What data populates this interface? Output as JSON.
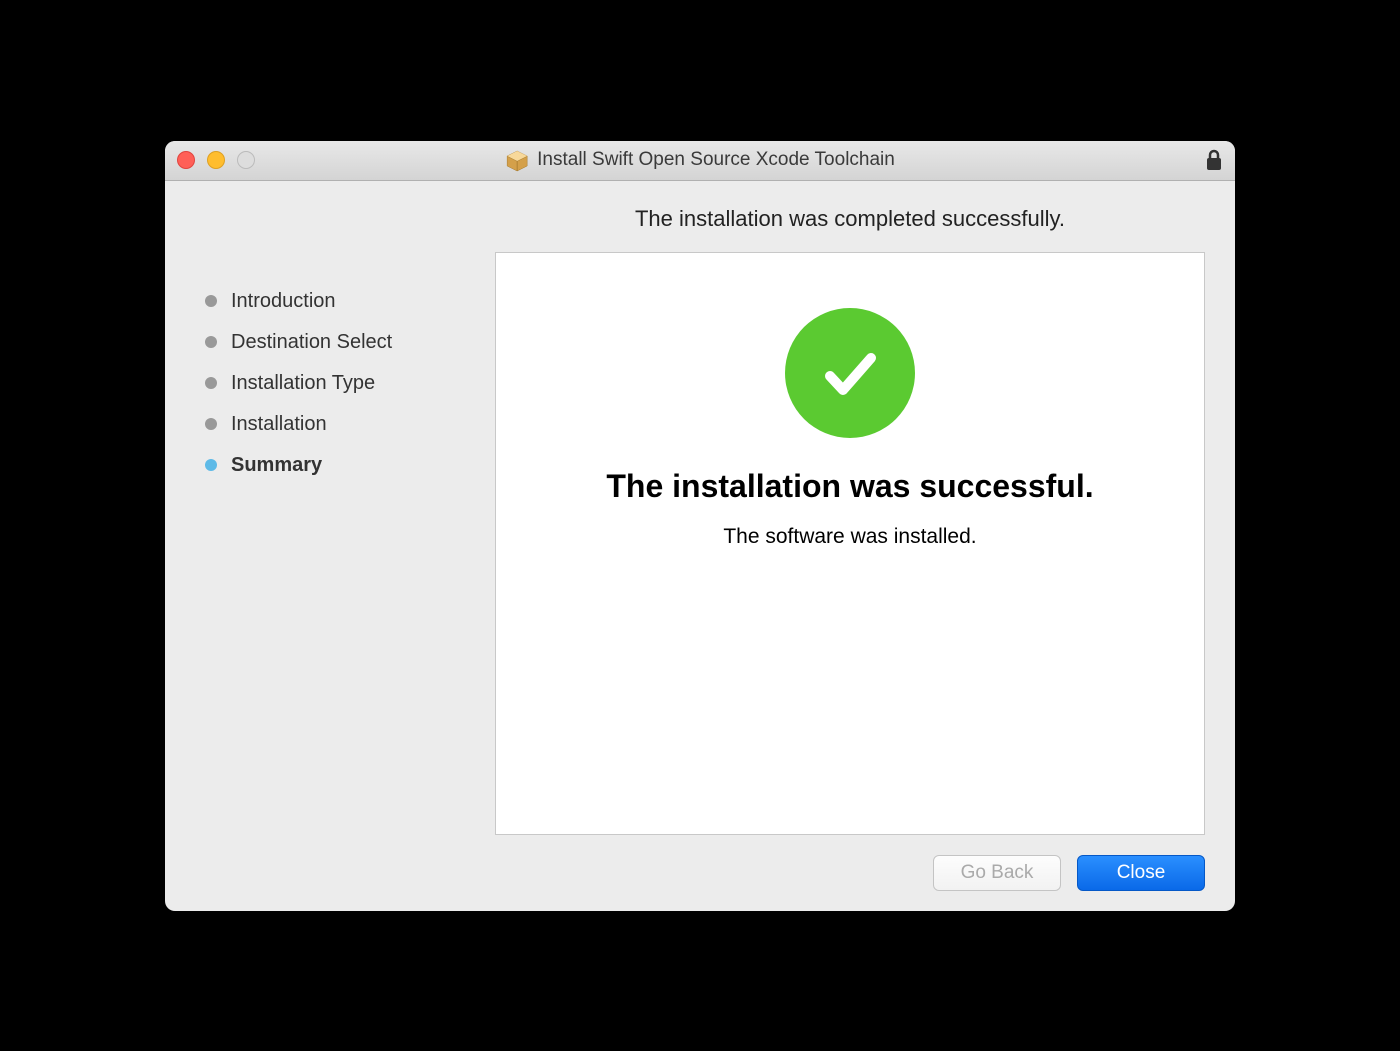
{
  "window": {
    "title": "Install Swift Open Source Xcode Toolchain"
  },
  "header": {
    "text": "The installation was completed successfully."
  },
  "sidebar": {
    "items": [
      {
        "label": "Introduction",
        "active": false
      },
      {
        "label": "Destination Select",
        "active": false
      },
      {
        "label": "Installation Type",
        "active": false
      },
      {
        "label": "Installation",
        "active": false
      },
      {
        "label": "Summary",
        "active": true
      }
    ]
  },
  "main": {
    "title": "The installation was successful.",
    "subtitle": "The software was installed."
  },
  "buttons": {
    "goback": "Go Back",
    "close": "Close"
  }
}
